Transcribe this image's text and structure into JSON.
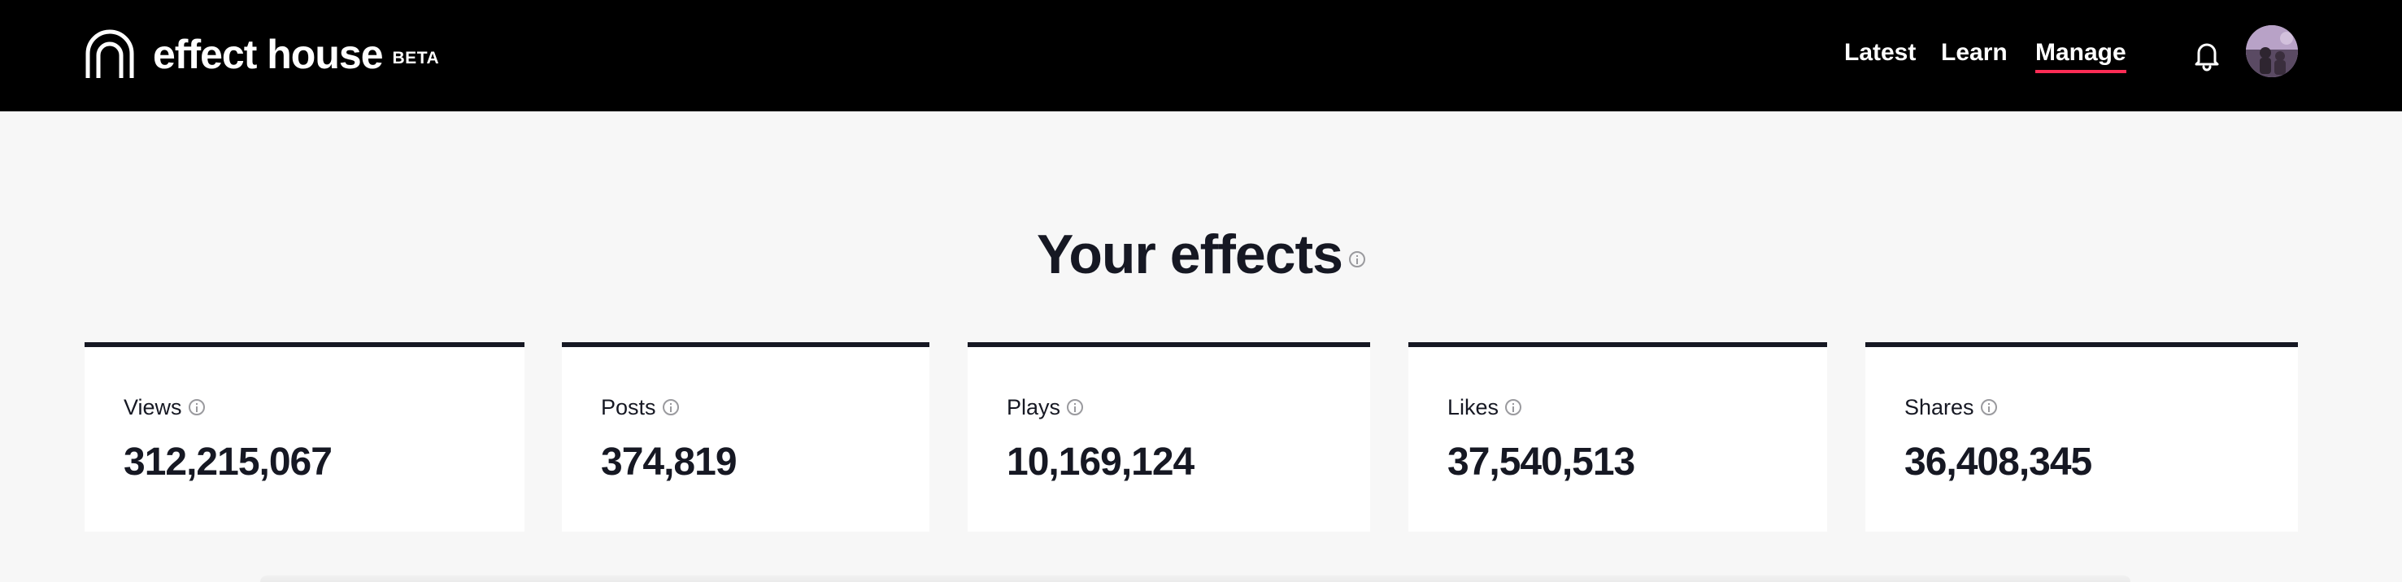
{
  "header": {
    "logo_text": "effect house",
    "logo_badge": "BETA",
    "nav": [
      {
        "label": "Latest"
      },
      {
        "label": "Learn"
      },
      {
        "label": "Manage",
        "active": true
      }
    ],
    "icons": {
      "notifications": "bell-icon",
      "profile": "avatar"
    },
    "accent_color": "#fe2c55"
  },
  "main": {
    "title": "Your effects",
    "stats": [
      {
        "label": "Views",
        "value": "312,215,067"
      },
      {
        "label": "Posts",
        "value": "374,819"
      },
      {
        "label": "Plays",
        "value": "10,169,124"
      },
      {
        "label": "Likes",
        "value": "37,540,513"
      },
      {
        "label": "Shares",
        "value": "36,408,345"
      }
    ]
  }
}
